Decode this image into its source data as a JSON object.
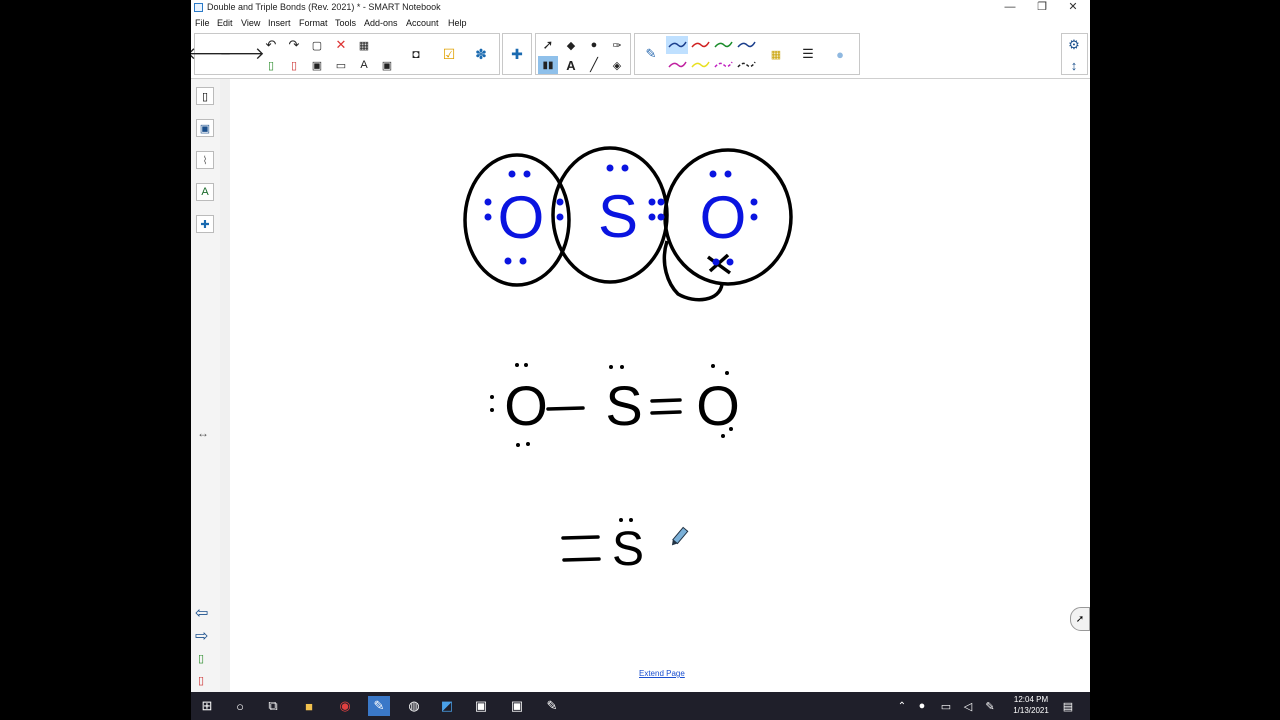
{
  "window": {
    "title": "Double and Triple Bonds (Rev. 2021) * - SMART Notebook",
    "minimize_glyph": "—",
    "restore_glyph": "❐",
    "close_glyph": "✕"
  },
  "menu": [
    "File",
    "Edit",
    "View",
    "Insert",
    "Format",
    "Tools",
    "Add-ons",
    "Account",
    "Help"
  ],
  "toolbar": {
    "icons": [
      "back-arrow-icon",
      "forward-arrow-icon",
      "undo-icon",
      "redo-icon",
      "paste-icon",
      "delete-icon",
      "table-icon",
      "add-page-icon",
      "delete-page-icon",
      "save-icon",
      "screen-shade-icon",
      "text-tool-icon",
      "capture-icon",
      "screen-capture-icon",
      "response-icon",
      "addons-icon",
      "select-icon",
      "shapes-icon",
      "fill-icon",
      "eraser-pen-icon",
      "pen-icon",
      "text-a-icon",
      "line-icon",
      "eraser-icon",
      "settings-icon"
    ],
    "pen_colors": [
      "#1a3e8c",
      "#d02020",
      "#1a8c2a",
      "#1a3e8c",
      "#c020a0",
      "#e8e020",
      "#c020c0",
      "#222222"
    ],
    "text_label": "A"
  },
  "sidebar": {
    "icons": [
      "page-sorter-icon",
      "gallery-icon",
      "attachments-icon",
      "properties-icon",
      "addons-puzzle-icon"
    ],
    "arrow_left": "⇦",
    "arrow_right": "⇨",
    "resize": "↔"
  },
  "canvas": {
    "atoms_top": [
      "O",
      "S",
      "O"
    ],
    "structure_line1": [
      "O",
      "—",
      "S",
      "=",
      "O"
    ],
    "structure_line2": [
      "=",
      "S"
    ],
    "extend_label": "Extend Page"
  },
  "taskbar": {
    "time": "12:04 PM",
    "date": "1/13/2021",
    "icons": [
      "windows-start-icon",
      "search-icon",
      "task-view-icon",
      "file-explorer-icon",
      "chrome-icon",
      "smart-notebook-icon",
      "app-icon",
      "photos-icon",
      "app2-icon",
      "app3-icon",
      "app4-icon"
    ]
  },
  "colors": {
    "ink_blue": "#0a14e0",
    "ink_black": "#000000",
    "link": "#1a4fd0",
    "taskbar": "#1f1f2a"
  }
}
